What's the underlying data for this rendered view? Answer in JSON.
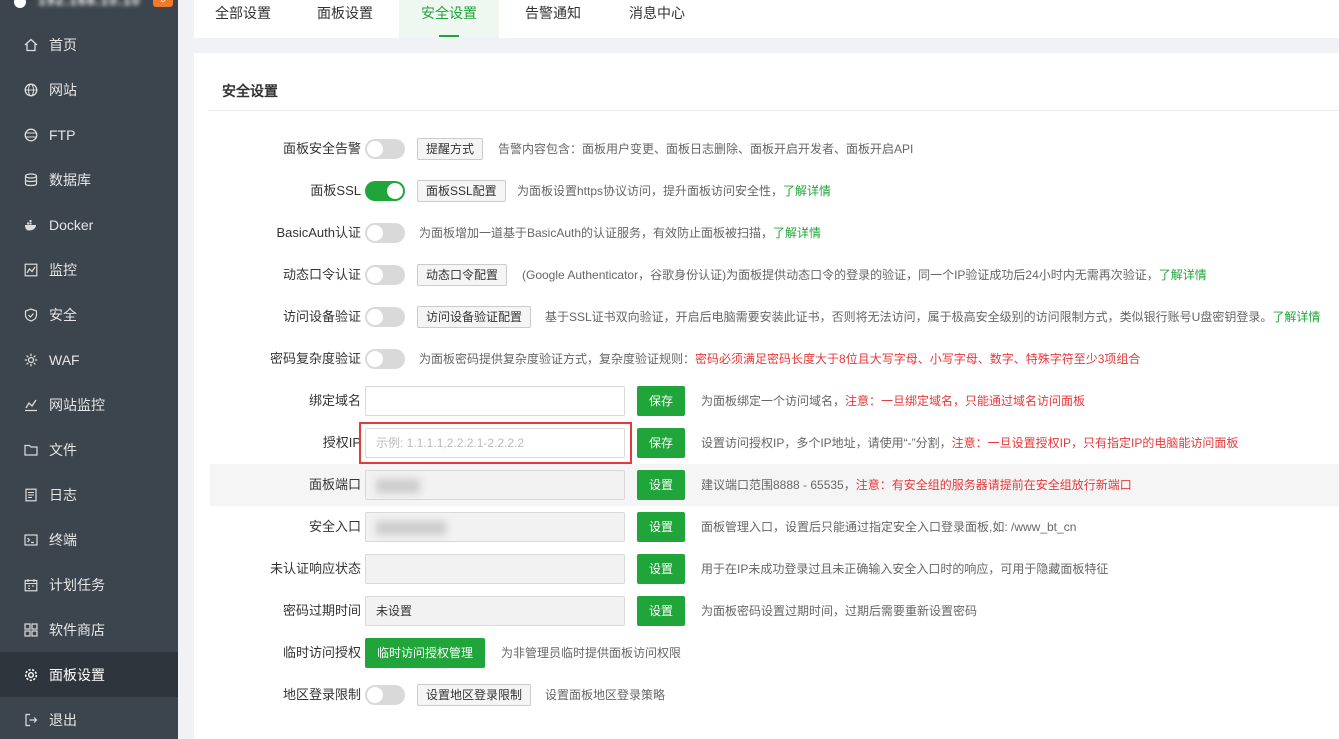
{
  "brand": {
    "name": "192.168.10.10",
    "badge": "0"
  },
  "sidebar": {
    "items": [
      {
        "label": "首页",
        "icon": "home-icon"
      },
      {
        "label": "网站",
        "icon": "globe-icon"
      },
      {
        "label": "FTP",
        "icon": "ftp-icon"
      },
      {
        "label": "数据库",
        "icon": "database-icon"
      },
      {
        "label": "Docker",
        "icon": "docker-icon"
      },
      {
        "label": "监控",
        "icon": "monitor-icon"
      },
      {
        "label": "安全",
        "icon": "shield-icon"
      },
      {
        "label": "WAF",
        "icon": "waf-icon"
      },
      {
        "label": "网站监控",
        "icon": "site-monitor-icon"
      },
      {
        "label": "文件",
        "icon": "folder-icon"
      },
      {
        "label": "日志",
        "icon": "log-icon"
      },
      {
        "label": "终端",
        "icon": "terminal-icon"
      },
      {
        "label": "计划任务",
        "icon": "calendar-icon"
      },
      {
        "label": "软件商店",
        "icon": "apps-icon"
      },
      {
        "label": "面板设置",
        "icon": "gear-icon"
      },
      {
        "label": "退出",
        "icon": "logout-icon"
      }
    ],
    "active_index": 14
  },
  "tabs": [
    "全部设置",
    "面板设置",
    "安全设置",
    "告警通知",
    "消息中心"
  ],
  "active_tab": "安全设置",
  "section_title": "安全设置",
  "rows": {
    "alert": {
      "label": "面板安全告警",
      "toggle": false,
      "button": "提醒方式",
      "desc": "告警内容包含：面板用户变更、面板日志删除、面板开启开发者、面板开启API"
    },
    "ssl": {
      "label": "面板SSL",
      "toggle": true,
      "button": "面板SSL配置",
      "desc": "为面板设置https协议访问，提升面板访问安全性，",
      "link": "了解详情"
    },
    "basic_auth": {
      "label": "BasicAuth认证",
      "toggle": false,
      "desc": "为面板增加一道基于BasicAuth的认证服务，有效防止面板被扫描，",
      "link": "了解详情"
    },
    "totp": {
      "label": "动态口令认证",
      "toggle": false,
      "button": "动态口令配置",
      "desc": "(Google Authenticator，谷歌身份认证)为面板提供动态口令的登录的验证，同一个IP验证成功后24小时内无需再次验证，",
      "link": "了解详情"
    },
    "device": {
      "label": "访问设备验证",
      "toggle": false,
      "button": "访问设备验证配置",
      "desc": "基于SSL证书双向验证，开启后电脑需要安装此证书，否则将无法访问，属于极高安全级别的访问限制方式，类似银行账号U盘密钥登录。",
      "link": "了解详情"
    },
    "pwd_complex": {
      "label": "密码复杂度验证",
      "toggle": false,
      "desc": "为面板密码提供复杂度验证方式，复杂度验证规则：",
      "warn": "密码必须满足密码长度大于8位且大写字母、小写字母、数字、特殊字符至少3项组合"
    },
    "domain": {
      "label": "绑定域名",
      "value": "",
      "button": "保存",
      "desc": "为面板绑定一个访问域名，",
      "warn": "注意：一旦绑定域名，只能通过域名访问面板"
    },
    "ip": {
      "label": "授权IP",
      "placeholder": "示例: 1.1.1.1,2.2.2.1-2.2.2.2",
      "button": "保存",
      "desc": "设置访问授权IP，多个IP地址，请使用“-”分割，",
      "warn": "注意：一旦设置授权IP，只有指定IP的电脑能访问面板"
    },
    "port": {
      "label": "面板端口",
      "button": "设置",
      "desc": "建议端口范围8888 - 65535，",
      "warn": "注意：有安全组的服务器请提前在安全组放行新端口"
    },
    "entry": {
      "label": "安全入口",
      "button": "设置",
      "desc": "面板管理入口，设置后只能通过指定安全入口登录面板,如: /www_bt_cn"
    },
    "unauth": {
      "label": "未认证响应状态",
      "value": "",
      "button": "设置",
      "desc": "用于在IP未成功登录过且未正确输入安全入口时的响应，可用于隐藏面板特征"
    },
    "pwd_expire": {
      "label": "密码过期时间",
      "value": "未设置",
      "button": "设置",
      "desc": "为面板密码设置过期时间，过期后需要重新设置密码"
    },
    "temp_auth": {
      "label": "临时访问授权",
      "button": "临时访问授权管理",
      "desc": "为非管理员临时提供面板访问权限"
    },
    "region": {
      "label": "地区登录限制",
      "toggle": false,
      "button": "设置地区登录限制",
      "desc": "设置面板地区登录策略"
    }
  },
  "colors": {
    "accent": "#20a53a",
    "warn": "#e4393c",
    "sidebar": "#3c444d"
  }
}
